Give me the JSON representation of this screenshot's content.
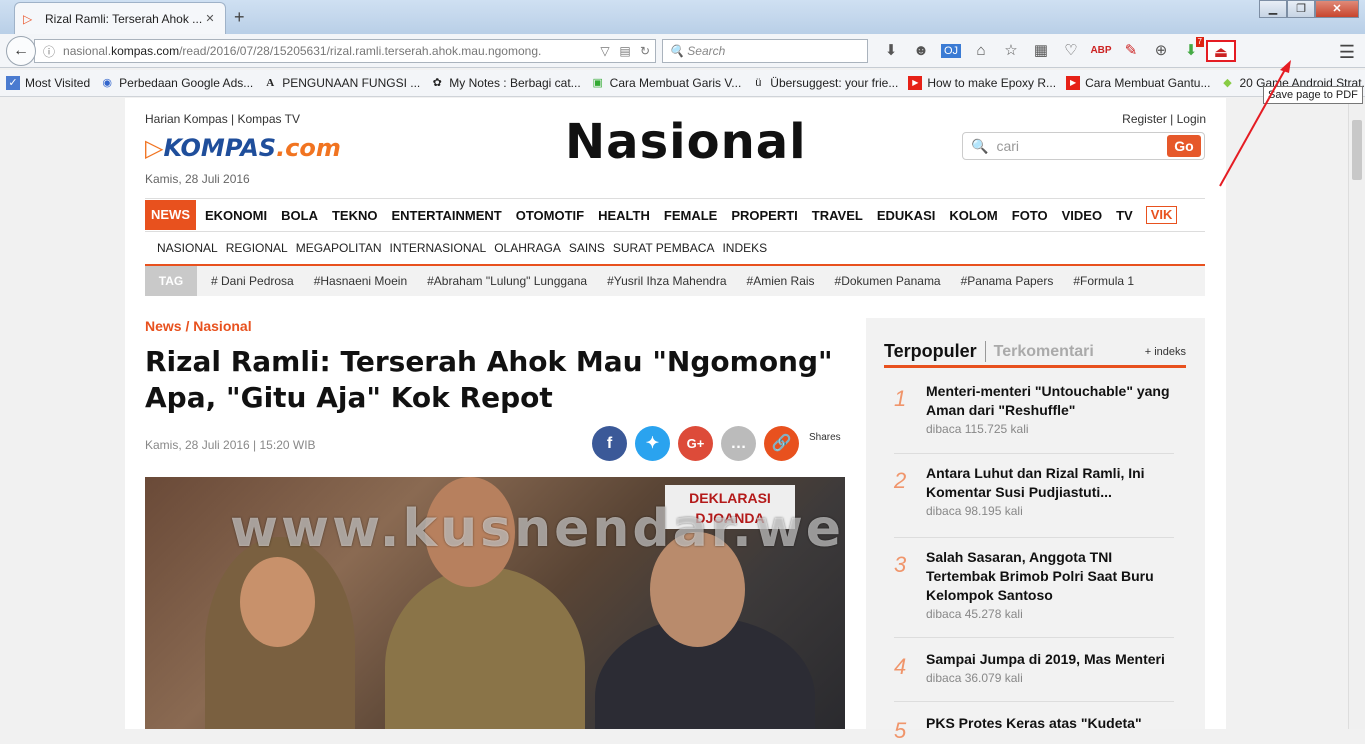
{
  "browser": {
    "tab_title": "Rizal Ramli: Terserah Ahok ...",
    "url_prefix": "nasional.",
    "url_domain": "kompas.com",
    "url_path": "/read/2016/07/28/15205631/rizal.ramli.terserah.ahok.mau.ngomong.",
    "search_placeholder": "Search",
    "tooltip": "Save page to PDF",
    "bookmarks": [
      {
        "icon": "star",
        "label": "Most Visited"
      },
      {
        "icon": "g",
        "label": "Perbedaan Google Ads..."
      },
      {
        "icon": "A",
        "label": "PENGUNAAN FUNGSI ..."
      },
      {
        "icon": "paw",
        "label": "My Notes : Berbagi cat..."
      },
      {
        "icon": "doc",
        "label": "Cara Membuat Garis V..."
      },
      {
        "icon": "u",
        "label": "Übersuggest: your frie..."
      },
      {
        "icon": "yt",
        "label": "How to make Epoxy R..."
      },
      {
        "icon": "yt",
        "label": "Cara Membuat Gantu..."
      },
      {
        "icon": "android",
        "label": "20 Game Android Strat..."
      }
    ]
  },
  "header": {
    "top_links": "Harian Kompas | Kompas TV",
    "logo_text": "KOMPAS",
    "logo_suffix": ".com",
    "date": "Kamis, 28 Juli 2016",
    "section_title": "Nasional",
    "auth_links": "Register | Login",
    "search_placeholder": "cari",
    "go_label": "Go"
  },
  "main_nav": [
    "NEWS",
    "EKONOMI",
    "BOLA",
    "TEKNO",
    "ENTERTAINMENT",
    "OTOMOTIF",
    "HEALTH",
    "FEMALE",
    "PROPERTI",
    "TRAVEL",
    "EDUKASI",
    "KOLOM",
    "FOTO",
    "VIDEO",
    "TV",
    "VIK"
  ],
  "sub_nav": [
    "NASIONAL",
    "REGIONAL",
    "MEGAPOLITAN",
    "INTERNASIONAL",
    "OLAHRAGA",
    "SAINS",
    "SURAT PEMBACA",
    "INDEKS"
  ],
  "tags": {
    "label": "TAG",
    "items": [
      "# Dani Pedrosa",
      "#Hasnaeni Moein",
      "#Abraham \"Lulung\" Lunggana",
      "#Yusril Ihza Mahendra",
      "#Amien Rais",
      "#Dokumen Panama",
      "#Panama Papers",
      "#Formula 1"
    ]
  },
  "article": {
    "breadcrumb": "News / Nasional",
    "headline": "Rizal Ramli: Terserah Ahok Mau \"Ngomong\" Apa, \"Gitu Aja\" Kok Repot",
    "pubdate": "Kamis, 28 Juli 2016 | 15:20 WIB",
    "shares_label": "Shares",
    "watermark": "www.kusnendar.web.id",
    "banner_text": "DEKLARASI DJOANDA"
  },
  "sidebar": {
    "tab_active": "Terpopuler",
    "tab_inactive": "Terkomentari",
    "index_link": "+ indeks",
    "items": [
      {
        "num": "1",
        "title": "Menteri-menteri \"Untouchable\" yang Aman dari \"Reshuffle\"",
        "count": "dibaca 115.725 kali"
      },
      {
        "num": "2",
        "title": "Antara Luhut dan Rizal Ramli, Ini Komentar Susi Pudjiastuti...",
        "count": "dibaca 98.195 kali"
      },
      {
        "num": "3",
        "title": "Salah Sasaran, Anggota TNI Tertembak Brimob Polri Saat Buru Kelompok Santoso",
        "count": "dibaca 45.278 kali"
      },
      {
        "num": "4",
        "title": "Sampai Jumpa di 2019, Mas Menteri",
        "count": "dibaca 36.079 kali"
      },
      {
        "num": "5",
        "title": "PKS Protes Keras atas \"Kudeta\"",
        "count": ""
      }
    ]
  },
  "colors": {
    "accent": "#e8511e",
    "brand_blue": "#1f4e9b",
    "highlight": "#e51c23"
  }
}
